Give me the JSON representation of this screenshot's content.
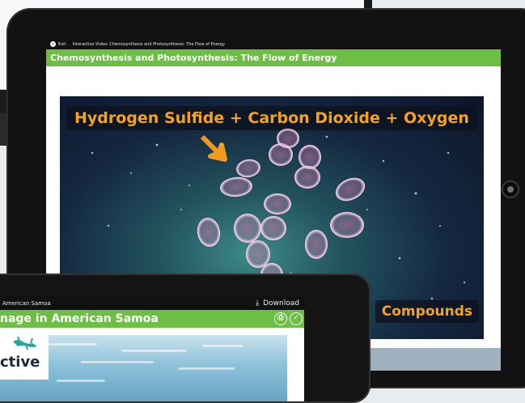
{
  "tablet_main": {
    "topbar": {
      "exit_label": "Exit",
      "breadcrumb": "Interactive Video: Chemosynthesis and Photosynthesis: The Flow of Energy"
    },
    "title": "Chemosynthesis and Photosynthesis: The Flow of Energy",
    "video": {
      "caption_top": "Hydrogen Sulfide + Carbon Dioxide + Oxygen",
      "caption_bottom": "Compounds"
    }
  },
  "tablet_secondary": {
    "topbar": {
      "breadcrumb": "American Samoa",
      "download_label": "Download"
    },
    "title": "nage in American Samoa"
  },
  "logo": {
    "text": "ctive"
  },
  "colors": {
    "accent_green": "#6cbf44",
    "caption_orange": "#f7a21c",
    "topbar_black": "#111111"
  },
  "icons": [
    "exit-icon",
    "download-icon",
    "print-icon",
    "check-icon",
    "home-button",
    "arrow-icon"
  ]
}
